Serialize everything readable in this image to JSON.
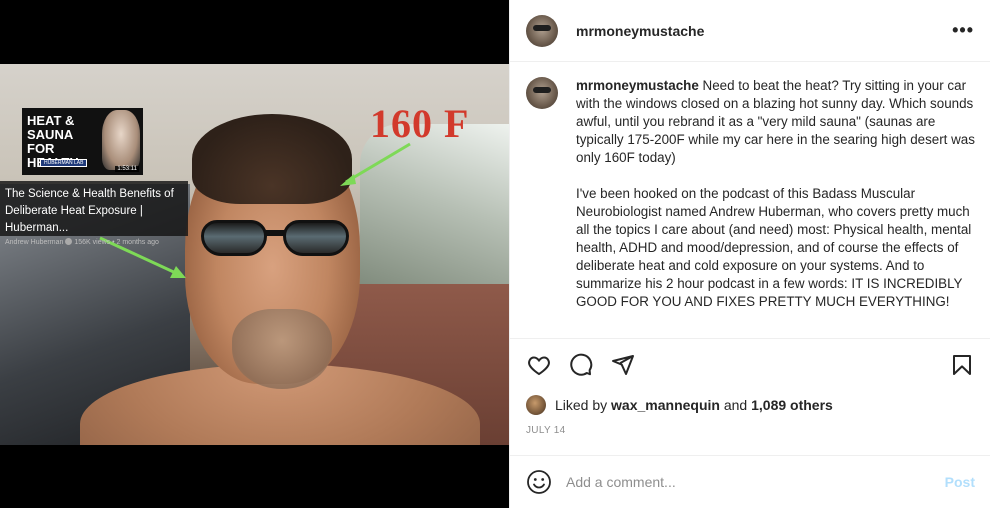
{
  "media": {
    "temperature_label": "160 F",
    "youtube": {
      "thumb_title": "HEAT & SAUNA FOR HEALTH",
      "thumb_lab": "HUBERMAN LAB",
      "duration": "1:53:11",
      "title_line1": "The Science & Health Benefits of",
      "title_line2": "Deliberate Heat Exposure | Huberman...",
      "channel": "Andrew Huberman",
      "meta": "156K views • 2 months ago"
    }
  },
  "post": {
    "username": "mrmoneymustache",
    "more_glyph": "•••",
    "caption": {
      "username": "mrmoneymustache",
      "paragraph1": "Need to beat the heat? Try sitting in your car with the windows closed on a blazing hot sunny day. Which sounds awful, until you rebrand it as a \"very mild sauna\" (saunas are typically 175-200F while my car here in the searing high desert was only 160F today)",
      "paragraph2": "I've been hooked on the podcast of this Badass Muscular Neurobiologist named Andrew Huberman, who covers pretty much all the topics I care about (and need) most: Physical health, mental health, ADHD and mood/depression, and of course the effects of deliberate heat and cold exposure on your systems. And to summarize his 2 hour podcast in a few words: IT IS INCREDIBLY GOOD FOR YOU AND FIXES PRETTY MUCH EVERYTHING!"
    },
    "likes": {
      "prefix": "Liked by",
      "liker": "wax_mannequin",
      "and": "and",
      "others": "1,089 others"
    },
    "date": "JULY 14",
    "comment": {
      "placeholder": "Add a comment...",
      "post_label": "Post"
    },
    "icons": [
      "heart-icon",
      "comment-icon",
      "share-icon",
      "bookmark-icon",
      "emoji-icon"
    ],
    "colors": {
      "post_button": "#b2dffc",
      "temp_label": "#d23a2c",
      "arrow": "#7ed957"
    }
  }
}
